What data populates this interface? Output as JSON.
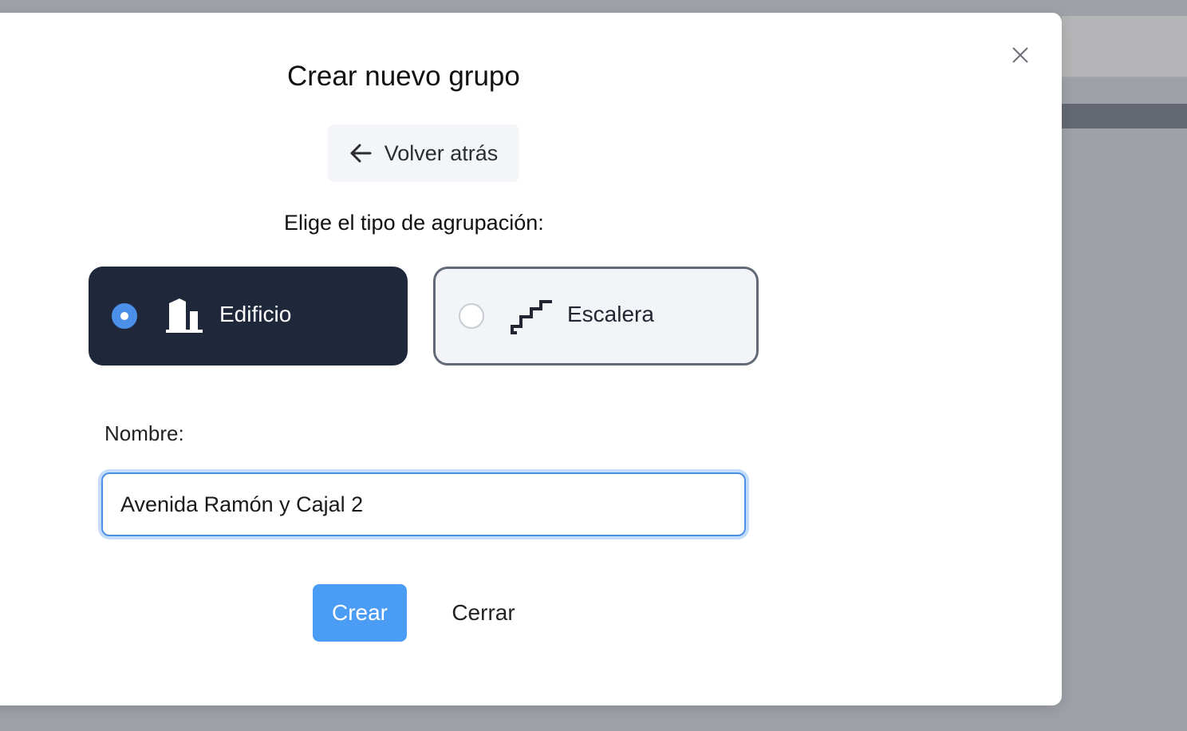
{
  "modal": {
    "title": "Crear nuevo grupo",
    "close_icon": "close-icon"
  },
  "back_button": {
    "label": "Volver atrás",
    "icon": "arrow-left-icon"
  },
  "grouping": {
    "prompt": "Elige el tipo de agrupación:",
    "options": [
      {
        "label": "Edificio",
        "icon": "building-icon",
        "selected": true
      },
      {
        "label": "Escalera",
        "icon": "stairs-icon",
        "selected": false
      }
    ]
  },
  "name_field": {
    "label": "Nombre:",
    "value": "Avenida Ramón y Cajal 2"
  },
  "actions": {
    "create_label": "Crear",
    "close_label": "Cerrar"
  },
  "colors": {
    "accent": "#4b9cf5",
    "selected_option_bg": "#1f283b",
    "overlay": "#9ea1a8"
  }
}
